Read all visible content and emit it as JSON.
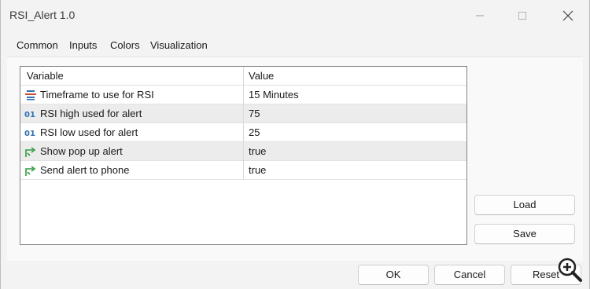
{
  "window": {
    "title": "RSI_Alert 1.0"
  },
  "tabs": [
    {
      "label": "Common"
    },
    {
      "label": "Inputs"
    },
    {
      "label": "Colors"
    },
    {
      "label": "Visualization"
    }
  ],
  "active_tab": "Inputs",
  "table": {
    "headers": {
      "variable": "Variable",
      "value": "Value"
    },
    "rows": [
      {
        "icon": "enum-list-icon",
        "variable": "Timeframe to use for RSI",
        "value": "15 Minutes"
      },
      {
        "icon": "integer-01-icon",
        "variable": "RSI high used for alert",
        "value": "75"
      },
      {
        "icon": "integer-01-icon",
        "variable": "RSI low used for alert",
        "value": "25"
      },
      {
        "icon": "boolean-arrow-icon",
        "variable": "Show pop up alert",
        "value": "true"
      },
      {
        "icon": "boolean-arrow-icon",
        "variable": "Send alert to phone",
        "value": "true"
      }
    ]
  },
  "side_buttons": {
    "load": "Load",
    "save": "Save"
  },
  "footer_buttons": {
    "ok": "OK",
    "cancel": "Cancel",
    "reset": "Reset"
  },
  "colors": {
    "accent": "#005fb8",
    "enum_icon": "#d04a3a",
    "int_icon": "#2f6fb3",
    "bool_icon": "#2e9a3e"
  }
}
